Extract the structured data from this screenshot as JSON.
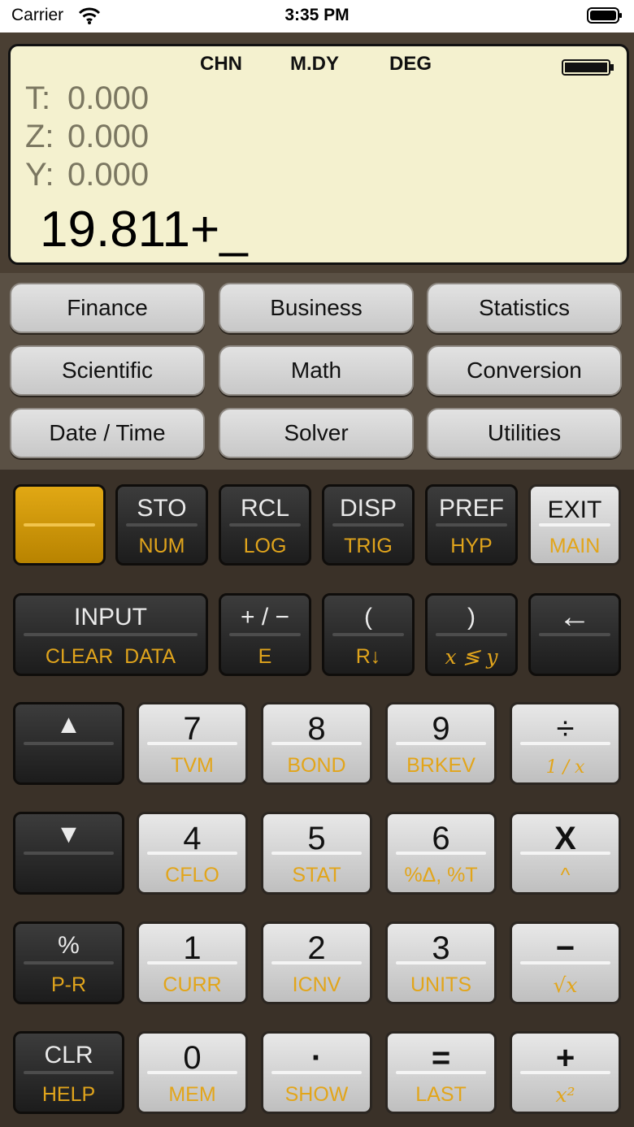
{
  "status_bar": {
    "carrier": "Carrier",
    "time": "3:35 PM"
  },
  "display": {
    "flags": [
      "CHN",
      "M.DY",
      "DEG"
    ],
    "registers": [
      {
        "label": "T:",
        "value": "0.000"
      },
      {
        "label": "Z:",
        "value": "0.000"
      },
      {
        "label": "Y:",
        "value": "0.000"
      }
    ],
    "x_entry": "19.811+_"
  },
  "menu_buttons": [
    "Finance",
    "Business",
    "Statistics",
    "Scientific",
    "Math",
    "Conversion",
    "Date / Time",
    "Solver",
    "Utilities"
  ],
  "keys": {
    "row1": [
      {
        "top": "",
        "bottom": ""
      },
      {
        "top": "STO",
        "bottom": "NUM"
      },
      {
        "top": "RCL",
        "bottom": "LOG"
      },
      {
        "top": "DISP",
        "bottom": "TRIG"
      },
      {
        "top": "PREF",
        "bottom": "HYP"
      },
      {
        "top": "EXIT",
        "bottom": "MAIN"
      }
    ],
    "row2": [
      {
        "top": "INPUT",
        "bottom": "CLEAR  DATA"
      },
      {
        "top": "+ / −",
        "bottom": "E"
      },
      {
        "top": "(",
        "bottom": "R↓"
      },
      {
        "top": ")",
        "bottom": "x ≶ y"
      },
      {
        "top": "←",
        "bottom": ""
      }
    ],
    "row3": [
      {
        "top": "▲",
        "bottom": ""
      },
      {
        "top": "7",
        "bottom": "TVM"
      },
      {
        "top": "8",
        "bottom": "BOND"
      },
      {
        "top": "9",
        "bottom": "BRKEV"
      },
      {
        "top": "÷",
        "bottom": "1 / x"
      }
    ],
    "row4": [
      {
        "top": "▼",
        "bottom": ""
      },
      {
        "top": "4",
        "bottom": "CFLO"
      },
      {
        "top": "5",
        "bottom": "STAT"
      },
      {
        "top": "6",
        "bottom": "%Δ, %T"
      },
      {
        "top": "X",
        "bottom": "^"
      }
    ],
    "row5": [
      {
        "top": "%",
        "bottom": "P-R"
      },
      {
        "top": "1",
        "bottom": "CURR"
      },
      {
        "top": "2",
        "bottom": "ICNV"
      },
      {
        "top": "3",
        "bottom": "UNITS"
      },
      {
        "top": "−",
        "bottom": "√x"
      }
    ],
    "row6": [
      {
        "top": "CLR",
        "bottom": "HELP"
      },
      {
        "top": "0",
        "bottom": "MEM"
      },
      {
        "top": "·",
        "bottom": "SHOW"
      },
      {
        "top": "=",
        "bottom": "LAST"
      },
      {
        "top": "+",
        "bottom": "x²"
      }
    ]
  },
  "colors": {
    "lcd": "#f4f1cf",
    "accent_gold": "#e0a41c",
    "shift_key": "#c99400"
  }
}
